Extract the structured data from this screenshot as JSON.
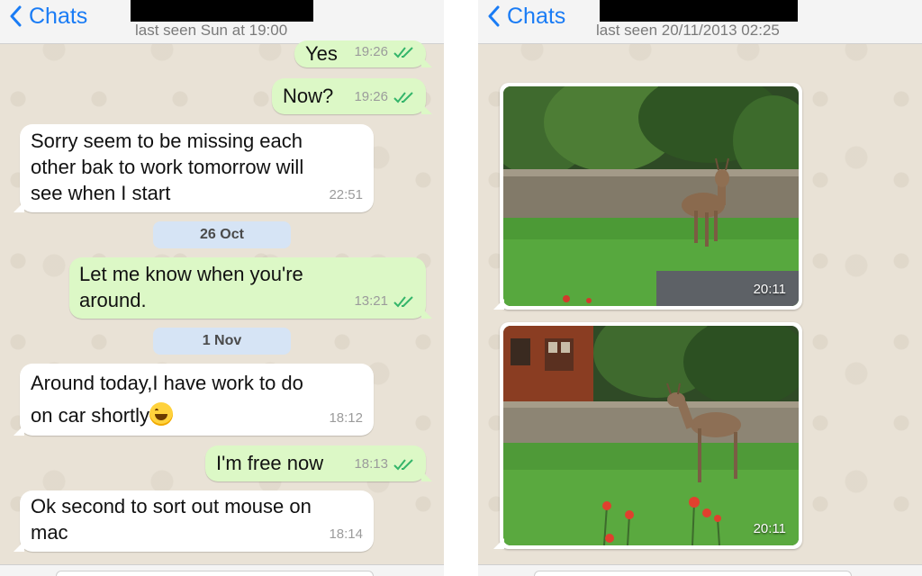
{
  "left_chat": {
    "nav": {
      "back_label": "Chats",
      "last_seen": "last seen Sun at 19:00"
    },
    "messages": [
      {
        "text": "Yes",
        "time": "19:26"
      },
      {
        "text": "Now?",
        "time": "19:26"
      },
      {
        "line1": "Sorry seem to be missing each",
        "line2": "other bak to work tomorrow will",
        "line3": "see when I start",
        "time": "22:51"
      },
      {
        "date": "26 Oct"
      },
      {
        "line1": "Let me know when you're",
        "line2": "around.",
        "time": "13:21"
      },
      {
        "date": "1 Nov"
      },
      {
        "line1": "Around today,I  have work to do",
        "line2": "on car shortly",
        "time": "18:12"
      },
      {
        "text": "I'm free now",
        "time": "18:13"
      },
      {
        "line1": "Ok second to sort out mouse on",
        "line2": "mac",
        "time": "18:14"
      }
    ]
  },
  "right_chat": {
    "nav": {
      "back_label": "Chats",
      "last_seen": "last seen 20/11/2013 02:25"
    },
    "photos": [
      {
        "time": "20:11"
      },
      {
        "time": "20:11"
      }
    ]
  },
  "icons": [
    "chevron-left-icon",
    "double-check-icon",
    "smile-emoji-icon"
  ],
  "colors": {
    "accent": "#1a7cf5",
    "outgoing_bubble": "#dcf8c6",
    "incoming_bubble": "#ffffff",
    "date_pill": "#d6e4f5",
    "read_ticks": "#34b7f1"
  }
}
